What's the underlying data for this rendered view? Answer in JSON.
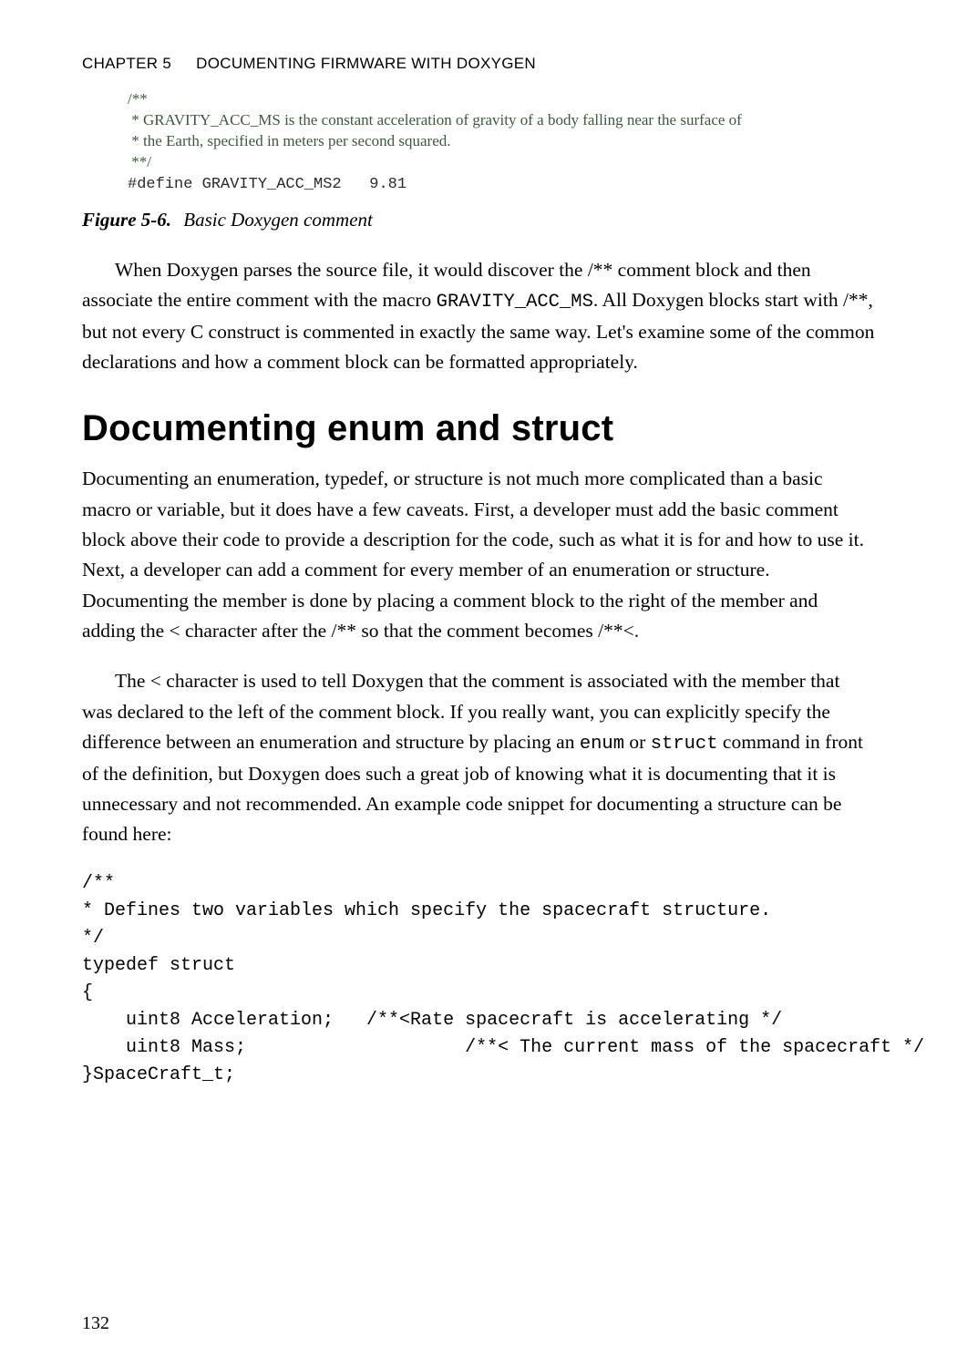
{
  "header": {
    "chapter_label": "Chapter 5",
    "chapter_title": "Documenting Firmware with Doxygen"
  },
  "figure_code": {
    "line1": "/**",
    "line2": " * GRAVITY_ACC_MS is the constant acceleration of gravity of a body falling near the surface of",
    "line3": " * the Earth, specified in meters per second squared.",
    "line4": " **/",
    "line5": "#define GRAVITY_ACC_MS2   9.81"
  },
  "figure_caption": {
    "label": "Figure 5-6.",
    "text": "Basic Doxygen comment"
  },
  "para1_a": "When Doxygen parses the source file, it would discover the /** comment block and then associate the entire comment with the macro ",
  "para1_mono": "GRAVITY_ACC_MS",
  "para1_b": ". All Doxygen blocks start with /**, but not every C construct is commented in exactly the same way. Let's examine some of the common declarations and how a comment block can be formatted appropriately.",
  "section_heading": "Documenting enum and struct",
  "para2": "Documenting an enumeration, typedef, or structure is not much more complicated than a basic macro or variable, but it does have a few caveats. First, a developer must add the basic comment block above their code to provide a description for the code, such as what it is for and how to use it. Next, a developer can add a comment for every member of an enumeration or structure. Documenting the member is done by placing a comment block to the right of the member and adding the < character after the /** so that the comment becomes /**<.",
  "para3_a": "The < character is used to tell Doxygen that the comment is associated with the member that was declared to the left of the comment block. If you really want, you can explicitly specify the difference between an enumeration and structure by placing an ",
  "para3_mono1": "enum",
  "para3_mid": " or ",
  "para3_mono2": "struct",
  "para3_b": " command in front of the definition, but Doxygen does such a great job of knowing what it is documenting that it is unnecessary and not recommended. An example code snippet for documenting a structure can be found here:",
  "code_block": "/**\n* Defines two variables which specify the spacecraft structure.\n*/\ntypedef struct\n{\n    uint8 Acceleration;   /**<Rate spacecraft is accelerating */\n    uint8 Mass;                    /**< The current mass of the spacecraft */\n}SpaceCraft_t;",
  "page_number": "132"
}
